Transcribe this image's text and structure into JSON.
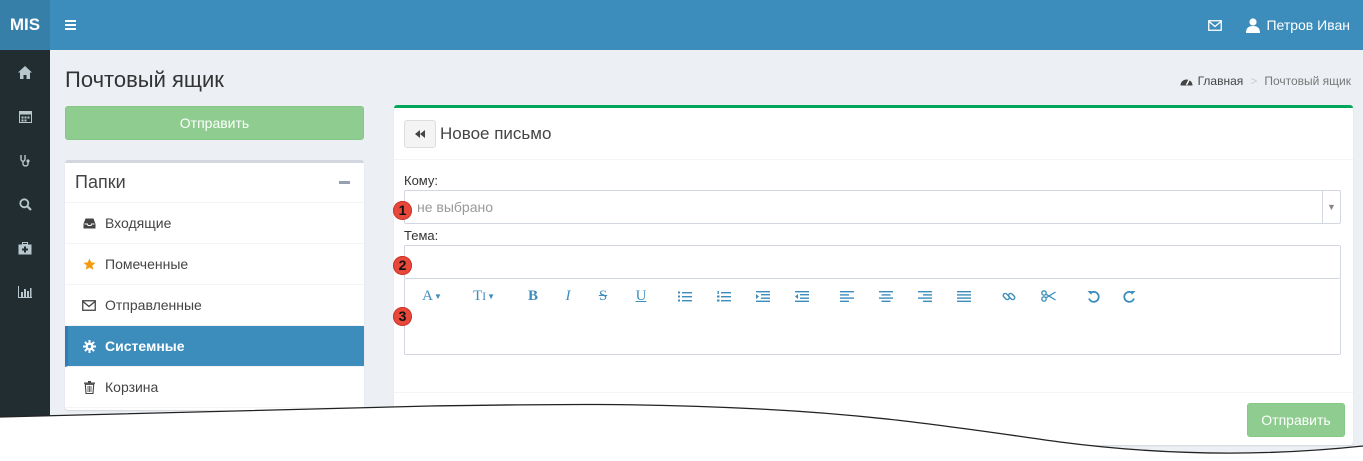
{
  "header": {
    "logo": "MIS",
    "user_name": "Петров Иван",
    "accent": "#3c8dbc"
  },
  "sidebar": {
    "icons": [
      "home-icon",
      "calendar-icon",
      "stethoscope-icon",
      "search-icon",
      "medkit-icon",
      "bar-chart-icon"
    ]
  },
  "page": {
    "title": "Почтовый ящик"
  },
  "breadcrumb": {
    "home": "Главная",
    "separator": ">",
    "current": "Почтовый ящик"
  },
  "compose_top": {
    "send_label": "Отправить"
  },
  "folders": {
    "title": "Папки",
    "items": [
      {
        "label": "Входящие",
        "icon": "inbox-icon"
      },
      {
        "label": "Помеченные",
        "icon": "star-icon"
      },
      {
        "label": "Отправленные",
        "icon": "envelope-icon"
      },
      {
        "label": "Системные",
        "icon": "gear-icon"
      },
      {
        "label": "Корзина",
        "icon": "trash-icon"
      }
    ]
  },
  "compose": {
    "title": "Новое письмо",
    "to_label": "Кому:",
    "to_placeholder": "не выбрано",
    "subject_label": "Тема:",
    "send_label": "Отправить"
  },
  "markers": [
    "1",
    "2",
    "3"
  ]
}
